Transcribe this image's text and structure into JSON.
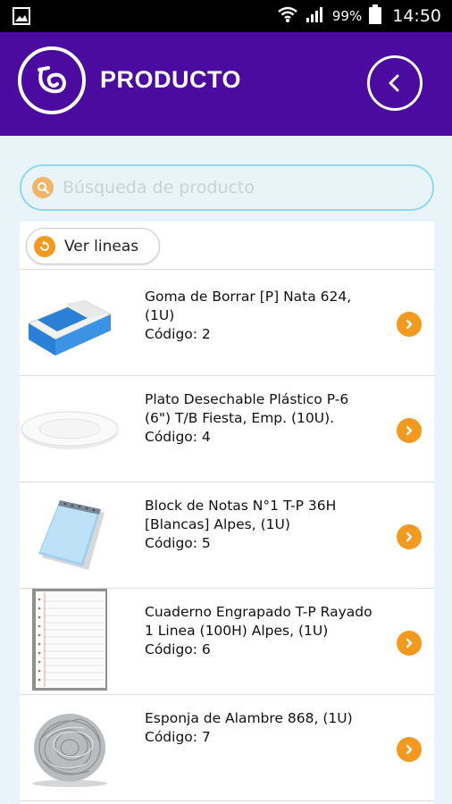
{
  "status": {
    "battery": "99%",
    "time": "14:50"
  },
  "header": {
    "title": "PRODUCTO",
    "logo_icon": "brand-logo-icon",
    "back_icon": "chevron-left-icon"
  },
  "search": {
    "placeholder": "Búsqueda de producto",
    "value": ""
  },
  "toolbar": {
    "lines_label": "Ver lineas"
  },
  "colors": {
    "primary": "#4b0aa0",
    "accent": "#f39a1e",
    "background": "#e9f4f9",
    "search_border": "#8fd8ef"
  },
  "products": [
    {
      "name": "Goma de Borrar [P] Nata 624, (1U)",
      "code": "Código: 2",
      "image": "eraser"
    },
    {
      "name": "Plato Desechable Plástico P-6 (6\") T/B Fiesta, Emp. (10U).",
      "code": "Código: 4",
      "image": "plate"
    },
    {
      "name": "Block de Notas N°1 T-P 36H [Blancas] Alpes, (1U)",
      "code": "Código: 5",
      "image": "notepad"
    },
    {
      "name": "Cuaderno Engrapado T-P Rayado 1 Linea (100H) Alpes, (1U)",
      "code": "Código: 6",
      "image": "notebook"
    },
    {
      "name": "Esponja de Alambre 868, (1U)",
      "code": "Código: 7",
      "image": "steel-wool"
    }
  ]
}
